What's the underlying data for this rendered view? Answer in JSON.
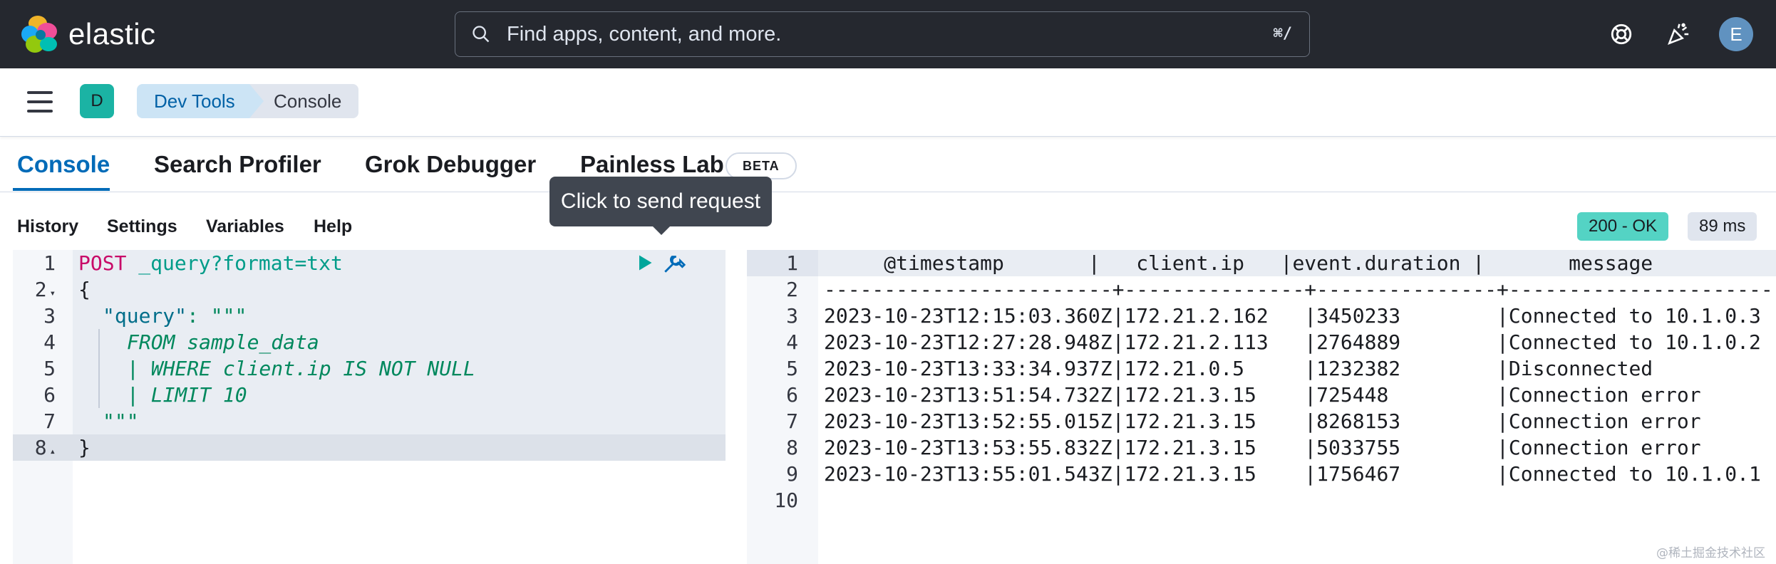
{
  "header": {
    "brand": "elastic",
    "search_placeholder": "Find apps, content, and more.",
    "search_shortcut": "⌘/",
    "help_icon": "lifebuoy-icon",
    "news_icon": "cheer-icon",
    "avatar_initial": "E"
  },
  "subheader": {
    "space_initial": "D",
    "breadcrumbs": [
      "Dev Tools",
      "Console"
    ]
  },
  "tabs": [
    {
      "label": "Console",
      "active": true
    },
    {
      "label": "Search Profiler",
      "active": false
    },
    {
      "label": "Grok Debugger",
      "active": false
    },
    {
      "label": "Painless Lab",
      "active": false
    }
  ],
  "beta_badge": "BETA",
  "tooltip": "Click to send request",
  "console_menu": [
    "History",
    "Settings",
    "Variables",
    "Help"
  ],
  "response_status": {
    "code": "200 - OK",
    "time": "89 ms"
  },
  "request_lines": [
    {
      "n": "1",
      "method": "POST",
      "path": "_query?format=txt"
    },
    {
      "n": "2",
      "text": "{"
    },
    {
      "n": "3",
      "key": "\"query\"",
      "rest": ": \"\"\""
    },
    {
      "n": "4",
      "text": "FROM sample_data"
    },
    {
      "n": "5",
      "text": "| WHERE client.ip IS NOT NULL"
    },
    {
      "n": "6",
      "text": "| LIMIT 10"
    },
    {
      "n": "7",
      "text": "\"\"\""
    },
    {
      "n": "8",
      "text": "}"
    }
  ],
  "response_lines": [
    {
      "n": "1",
      "text": "     @timestamp       |   client.ip   |event.duration |       message"
    },
    {
      "n": "2",
      "text": "------------------------+---------------+---------------+-----------------------"
    },
    {
      "n": "3",
      "text": "2023-10-23T12:15:03.360Z|172.21.2.162   |3450233        |Connected to 10.1.0.3"
    },
    {
      "n": "4",
      "text": "2023-10-23T12:27:28.948Z|172.21.2.113   |2764889        |Connected to 10.1.0.2"
    },
    {
      "n": "5",
      "text": "2023-10-23T13:33:34.937Z|172.21.0.5     |1232382        |Disconnected"
    },
    {
      "n": "6",
      "text": "2023-10-23T13:51:54.732Z|172.21.3.15    |725448         |Connection error"
    },
    {
      "n": "7",
      "text": "2023-10-23T13:52:55.015Z|172.21.3.15    |8268153        |Connection error"
    },
    {
      "n": "8",
      "text": "2023-10-23T13:53:55.832Z|172.21.3.15    |5033755        |Connection error"
    },
    {
      "n": "9",
      "text": "2023-10-23T13:55:01.543Z|172.21.3.15    |1756467        |Connected to 10.1.0.1"
    },
    {
      "n": "10",
      "text": ""
    }
  ],
  "watermark": "@稀土掘金技术社区",
  "colors": {
    "header_bg": "#25282f",
    "accent": "#006bb8",
    "status_ok": "#54d3c4",
    "method": "#c80a68"
  }
}
